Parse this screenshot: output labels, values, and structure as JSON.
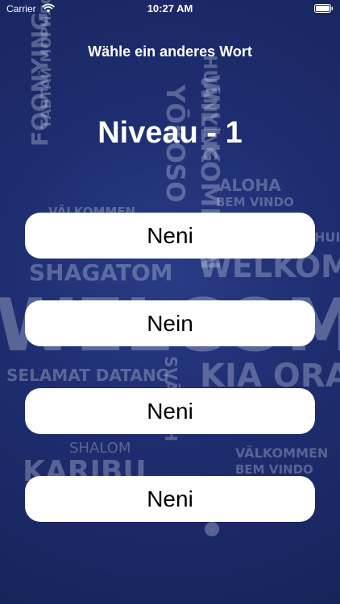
{
  "status_bar": {
    "carrier": "Carrier",
    "time": "10:27 AM"
  },
  "header": {
    "title": "Wähle ein anderes Wort"
  },
  "level": {
    "label": "Niveau - 1"
  },
  "answers": [
    {
      "label": "Neni"
    },
    {
      "label": "Nein"
    },
    {
      "label": "Neni"
    },
    {
      "label": "Neni"
    }
  ],
  "background_words": {
    "huanying": "HUĀNYÍNG",
    "willkommen": "WILLKOMMEN",
    "yoosoo": "YŌKOSO",
    "foonying": "FOONYING",
    "cyr1": "ТАВТАЙ МОРИЛОГТУН",
    "aloha": "ALOHA",
    "bemvindo1": "BEM VINDO",
    "valkommen1": "VÄLKOMMEN",
    "shagatom": "SHAGATOM",
    "welkom": "WELKOM",
    "huiz": "HUIZ",
    "welcome": "WELCOME",
    "selamat": "SELAMAT DATANG",
    "kiaora": "KIA ORA",
    "sv": "SVĀGATH",
    "cyr2": "ТАВТАЙ МОРИЛОГТУН",
    "shalom": "SHALOM",
    "valkommen2": "VÄLKOMMEN",
    "bemvindo2": "BEM VINDO",
    "karibu": "KARIBU"
  },
  "colors": {
    "background": "#1f2f73",
    "button": "#ffffff",
    "text_light": "#ffffff",
    "text_dark": "#000000"
  }
}
